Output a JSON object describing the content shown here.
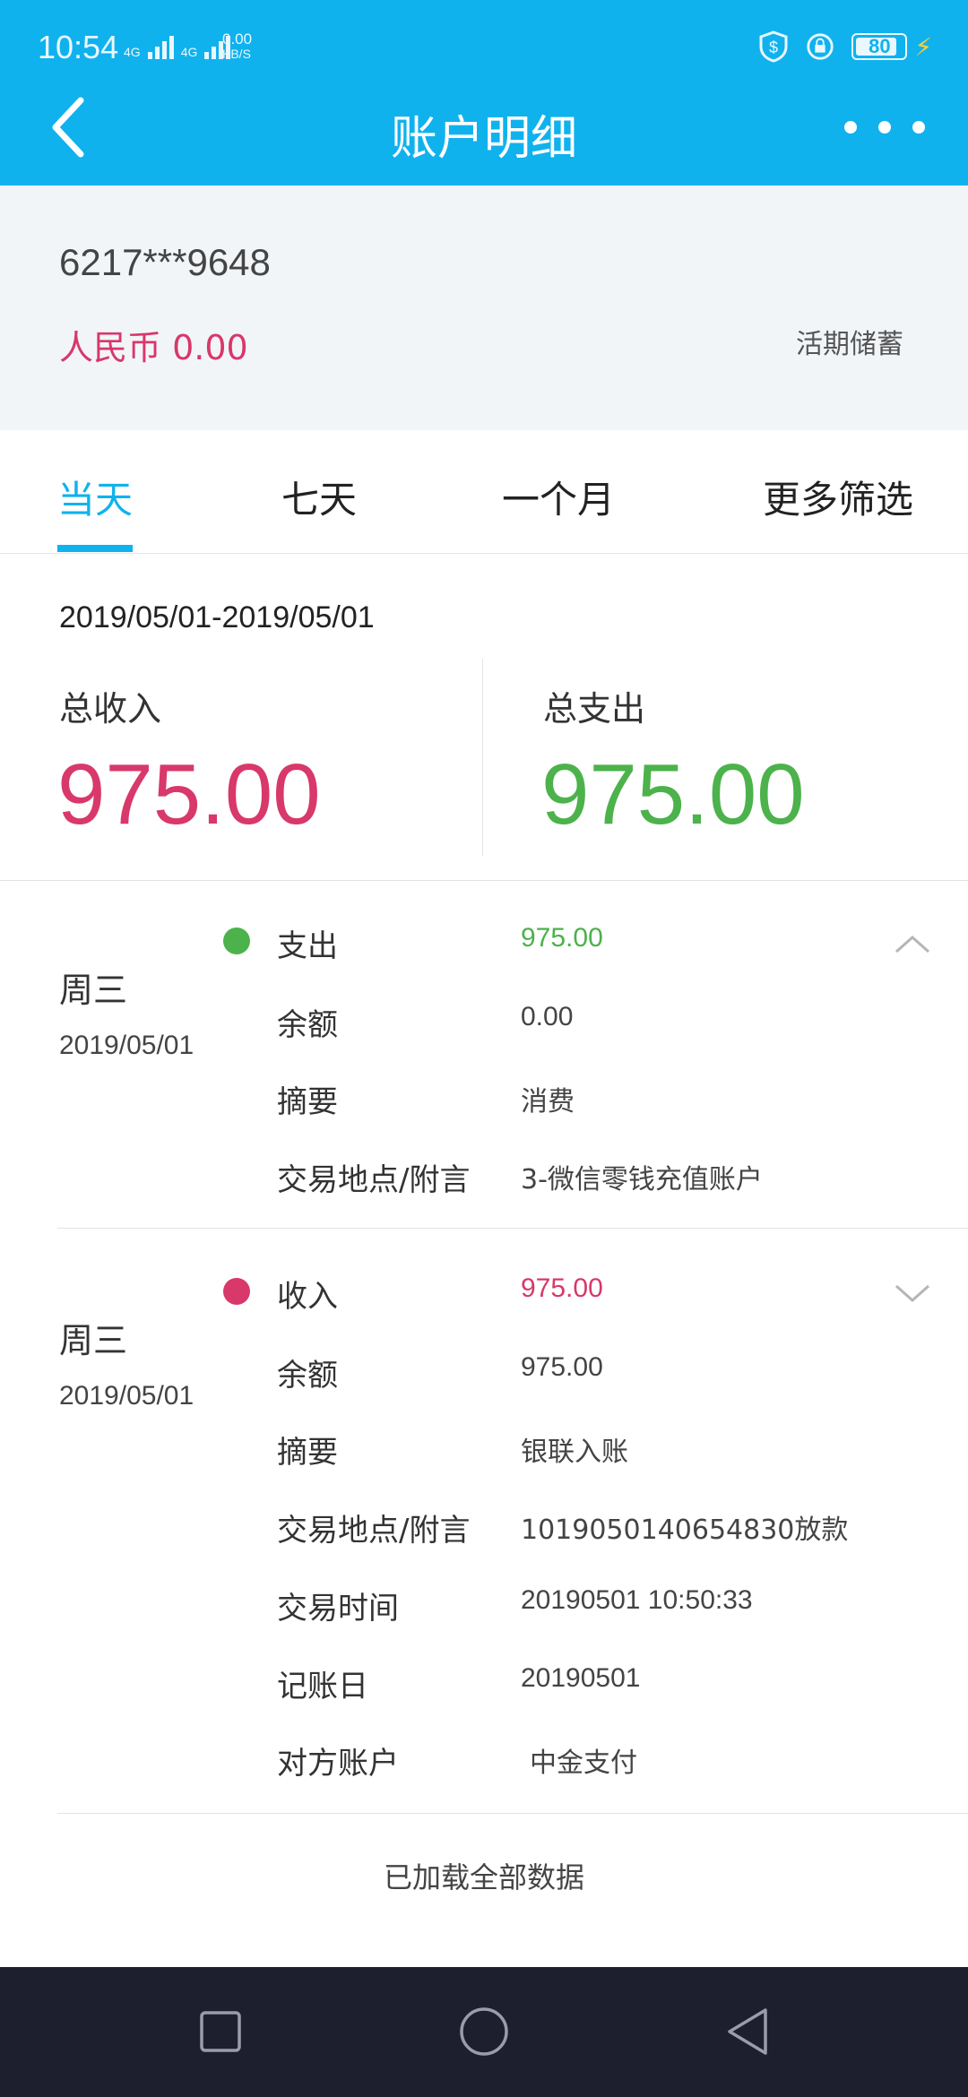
{
  "status_bar": {
    "time": "10:54",
    "net1": "4G",
    "net2": "4G",
    "speed_value": "0.00",
    "speed_unit": "KB/S",
    "battery": "80"
  },
  "header": {
    "title": "账户明细"
  },
  "account": {
    "number": "6217***9648",
    "balance": "人民币 0.00",
    "type": "活期储蓄"
  },
  "tabs": [
    {
      "label": "当天"
    },
    {
      "label": "七天"
    },
    {
      "label": "一个月"
    },
    {
      "label": "更多筛选"
    }
  ],
  "summary": {
    "date_range": "2019/05/01-2019/05/01",
    "income_label": "总收入",
    "income_value": "975.00",
    "expense_label": "总支出",
    "expense_value": "975.00"
  },
  "transactions": [
    {
      "weekday": "周三",
      "date": "2019/05/01",
      "rows": [
        {
          "label": "支出",
          "value": "975.00"
        },
        {
          "label": "余额",
          "value": "0.00"
        },
        {
          "label": "摘要",
          "value": "消费"
        },
        {
          "label": "交易地点/附言",
          "value": "3-微信零钱充值账户"
        }
      ]
    },
    {
      "weekday": "周三",
      "date": "2019/05/01",
      "rows": [
        {
          "label": "收入",
          "value": "975.00"
        },
        {
          "label": "余额",
          "value": "975.00"
        },
        {
          "label": "摘要",
          "value": "银联入账"
        },
        {
          "label": "交易地点/附言",
          "value": "1019050140654830放款"
        },
        {
          "label": "交易时间",
          "value": "20190501 10:50:33"
        },
        {
          "label": "记账日",
          "value": "20190501"
        },
        {
          "label": "对方账户",
          "value": "中金支付"
        }
      ]
    }
  ],
  "footer": {
    "loaded_text": "已加载全部数据"
  },
  "colors": {
    "accent": "#10b2ee",
    "income": "#d8386a",
    "expense": "#4cb24b",
    "navbar": "#1d1f2e"
  }
}
